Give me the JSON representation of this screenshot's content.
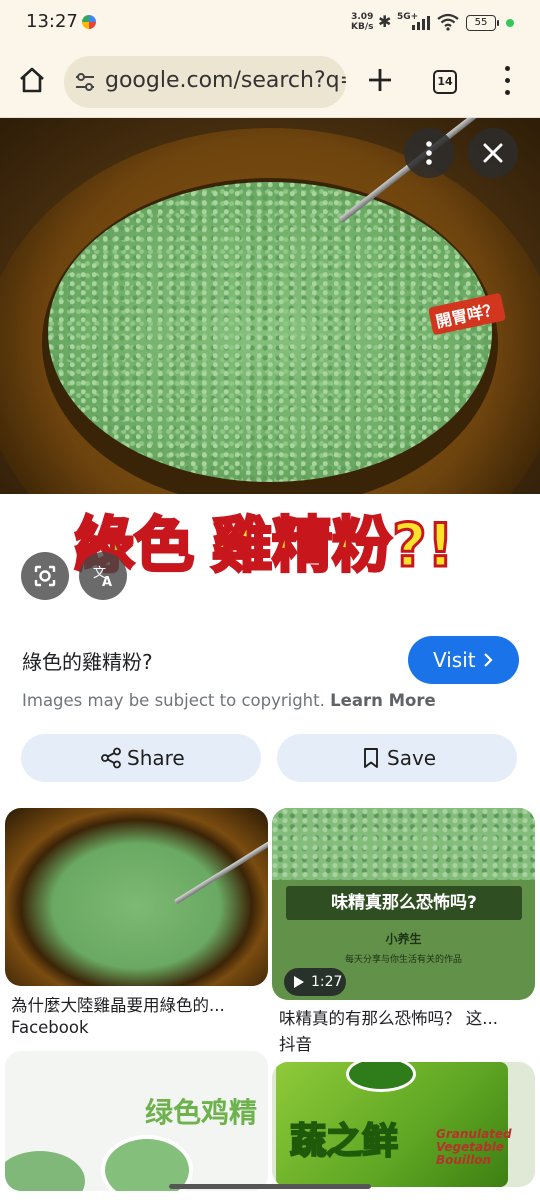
{
  "status_bar": {
    "time": "13:27",
    "net_speed_value": "3.09",
    "net_speed_unit": "KB/s",
    "network": "5G+",
    "battery": "55"
  },
  "toolbar": {
    "url": "google.com/search?q=",
    "tab_count": "14"
  },
  "hero": {
    "caption_part1": "綠色",
    "caption_part2": "雞精粉?!",
    "sticker_note": "開胃咩？"
  },
  "result": {
    "title": "綠色的雞精粉?",
    "visit_label": "Visit",
    "copyright_text": "Images may be subject to copyright.",
    "learn_more": "Learn More",
    "share_label": "Share",
    "save_label": "Save"
  },
  "grid": [
    {
      "title": "為什麼大陸雞晶要用綠色的...",
      "source": "Facebook"
    },
    {
      "title": "味精真的有那么恐怖吗？ 这...",
      "source": "抖音",
      "duration": "1:27",
      "overlay_title": "味精真那么恐怖吗?",
      "overlay_sub": "小养生",
      "overlay_sub2": "每天分享与你生活有关的作品"
    },
    {
      "overlay_text": "绿色鸡精"
    },
    {
      "overlay_brand": "蔬之鲜",
      "overlay_en_1": "Granulated",
      "overlay_en_2": "Vegetable",
      "overlay_en_3": "Bouillon"
    }
  ],
  "colors": {
    "accent": "#1a73e8",
    "pill_bg": "#e5edf9",
    "toolbar_bg": "#fbf6e9"
  }
}
